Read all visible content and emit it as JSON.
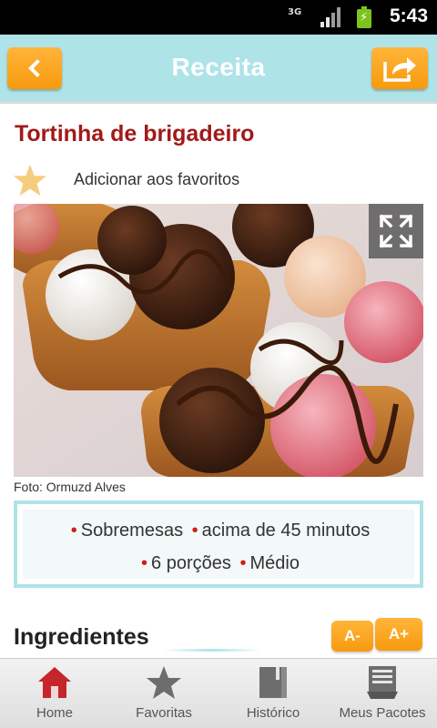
{
  "status_bar": {
    "network": "3G",
    "time": "5:43"
  },
  "header": {
    "title": "Receita"
  },
  "recipe": {
    "title": "Tortinha de brigadeiro",
    "favorite_label": "Adicionar aos favoritos",
    "photo_credit": "Foto: Ormuzd Alves",
    "info": {
      "category": "Sobremesas",
      "time": "acima de 45 minutos",
      "servings": "6 porções",
      "difficulty": "Médio"
    },
    "ingredients_heading": "Ingredientes",
    "font_decrease": "A-",
    "font_increase": "A+"
  },
  "bottom_nav": [
    {
      "label": "Home",
      "icon": "home-icon"
    },
    {
      "label": "Favoritas",
      "icon": "star-icon"
    },
    {
      "label": "Histórico",
      "icon": "book-icon"
    },
    {
      "label": "Meus Pacotes",
      "icon": "package-icon"
    }
  ],
  "colors": {
    "header_bg": "#aee3e8",
    "accent_orange": "#f89a0e",
    "title_red": "#a11a1a",
    "home_red": "#c4262b"
  }
}
